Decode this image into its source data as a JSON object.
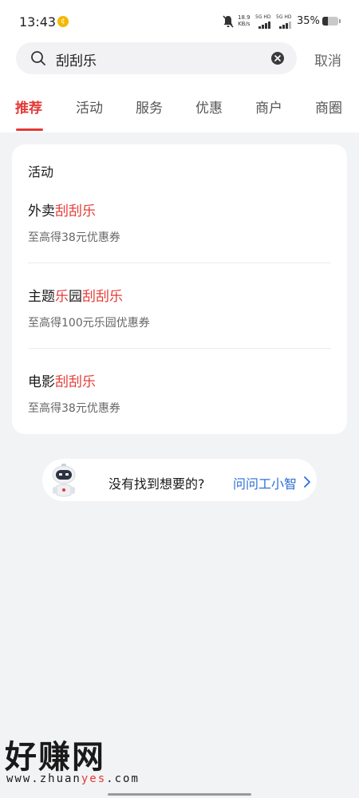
{
  "status_bar": {
    "time": "13:43",
    "net_speed_value": "18.9",
    "net_speed_unit": "KB/s",
    "sim1_label": "5G HD",
    "sim2_label": "5G HD",
    "battery_percent_text": "35%",
    "battery_level": 0.35
  },
  "search": {
    "query": "刮刮乐",
    "cancel_label": "取消"
  },
  "tabs": [
    "推荐",
    "活动",
    "服务",
    "优惠",
    "商户",
    "商圈"
  ],
  "active_tab": "推荐",
  "results": {
    "section_title": "活动",
    "items": [
      {
        "title_pre": "外卖",
        "title_mid": "",
        "title_mid2": "",
        "title_hl": "刮刮乐",
        "subtitle": "至高得38元优惠券"
      },
      {
        "title_pre": "主题",
        "title_mid": "乐",
        "title_mid2": "园",
        "title_hl": "刮刮乐",
        "subtitle": "至高得100元乐园优惠券"
      },
      {
        "title_pre": "电影",
        "title_mid": "",
        "title_mid2": "",
        "title_hl": "刮刮乐",
        "subtitle": "至高得38元优惠券"
      }
    ]
  },
  "assistant": {
    "prompt": "没有找到想要的?",
    "link_label": "问问工小智"
  },
  "watermark": {
    "brand": "好赚网",
    "url_pre": "www.zhuan",
    "url_hl": "yes",
    "url_post": ".com"
  },
  "colors": {
    "accent": "#e53935",
    "link": "#2f6fd6",
    "background": "#f2f3f5"
  }
}
